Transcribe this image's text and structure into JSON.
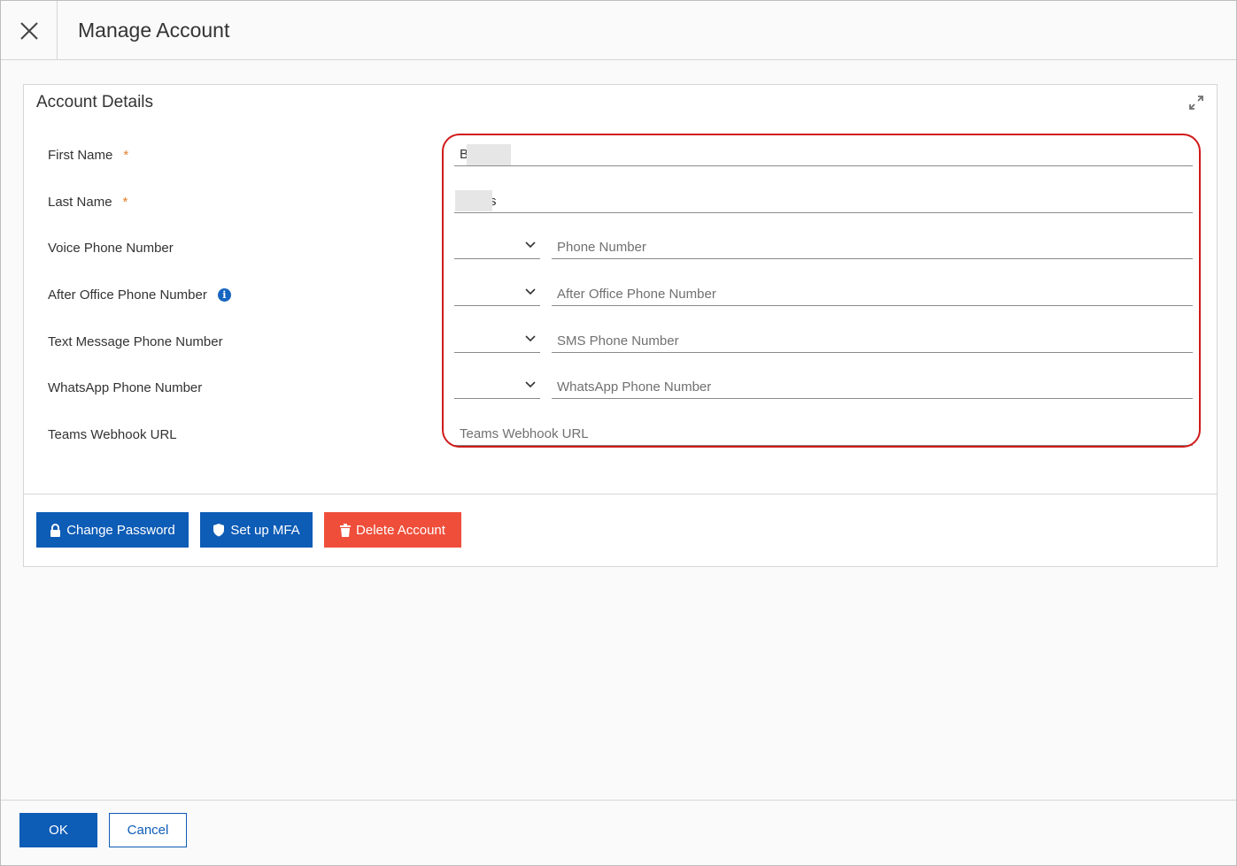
{
  "header": {
    "title": "Manage Account",
    "close_icon": "close-icon"
  },
  "panel": {
    "title": "Account Details",
    "expand_icon": "expand-icon",
    "fields": {
      "first_name": {
        "label": "First Name",
        "required_mark": "*",
        "value": "B"
      },
      "last_name": {
        "label": "Last Name",
        "required_mark": "*",
        "value": "s"
      },
      "voice_phone": {
        "label": "Voice Phone Number",
        "placeholder": "Phone Number"
      },
      "after_office_phone": {
        "label": "After Office Phone Number",
        "placeholder": "After Office Phone Number"
      },
      "text_message_phone": {
        "label": "Text Message Phone Number",
        "placeholder": "SMS Phone Number"
      },
      "whatsapp_phone": {
        "label": "WhatsApp Phone Number",
        "placeholder": "WhatsApp Phone Number"
      },
      "teams_webhook": {
        "label": "Teams Webhook URL",
        "placeholder": "Teams Webhook URL"
      }
    },
    "actions": {
      "change_password": "Change Password",
      "setup_mfa": "Set up MFA",
      "delete_account": "Delete Account"
    }
  },
  "footer": {
    "ok": "OK",
    "cancel": "Cancel"
  },
  "colors": {
    "primary": "#0d5cb6",
    "danger": "#ef4e3a",
    "highlight": "#d01a1a",
    "required": "#e57f2c"
  }
}
